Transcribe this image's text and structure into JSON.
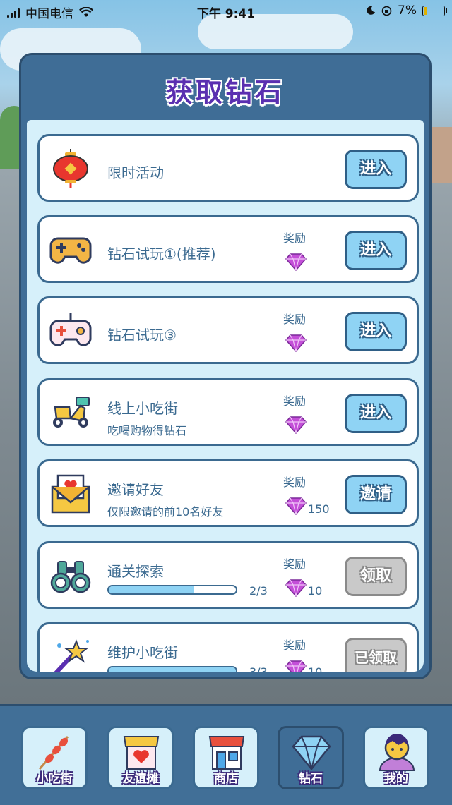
{
  "status_bar": {
    "carrier": "中国电信",
    "time": "下午 9:41",
    "battery": "7%"
  },
  "header": {
    "title": "获取钻石"
  },
  "reward_label": "奖励",
  "rows": [
    {
      "title": "限时活动",
      "button": "进入"
    },
    {
      "title": "钻石试玩①(推荐)",
      "button": "进入"
    },
    {
      "title": "钻石试玩③",
      "button": "进入"
    },
    {
      "title": "线上小吃街",
      "subtitle": "吃喝购物得钻石",
      "button": "进入"
    },
    {
      "title": "邀请好友",
      "subtitle": "仅限邀请的前10名好友",
      "reward_amount": "150",
      "button": "邀请"
    },
    {
      "title": "通关探索",
      "progress_text": "2/3",
      "progress_value": 0.667,
      "reward_amount": "10",
      "button": "领取"
    },
    {
      "title": "维护小吃街",
      "progress_text": "3/3",
      "progress_value": 1.0,
      "reward_amount": "10",
      "button": "已领取"
    }
  ],
  "tabs": [
    {
      "label": "小吃街",
      "icon": "skewer-icon"
    },
    {
      "label": "友谊摊",
      "icon": "heart-stall-icon"
    },
    {
      "label": "商店",
      "icon": "store-icon"
    },
    {
      "label": "钻石",
      "icon": "diamond-icon",
      "active": true
    },
    {
      "label": "我的",
      "icon": "avatar-icon"
    }
  ],
  "colors": {
    "accent": "#8fd3f4",
    "panel": "#3f6d96",
    "title": "#5a2fb0",
    "gem": "#c44fd8"
  }
}
